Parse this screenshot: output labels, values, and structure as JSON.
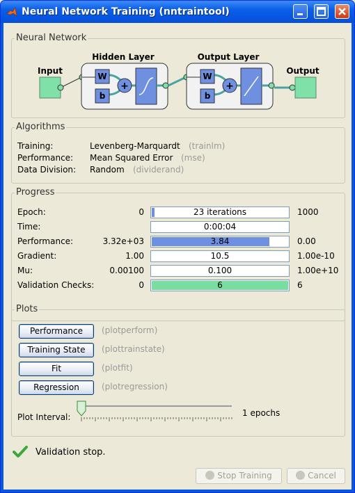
{
  "window": {
    "title": "Neural Network Training (nntraintool)"
  },
  "network": {
    "section_title": "Neural Network",
    "input_label": "Input",
    "hidden_label": "Hidden Layer",
    "output_layer_label": "Output Layer",
    "output_label": "Output",
    "w_label": "W",
    "b_label": "b",
    "plus_label": "+"
  },
  "algorithms": {
    "section_title": "Algorithms",
    "rows": [
      {
        "label": "Training:",
        "value": "Levenberg-Marquardt",
        "code": "(trainlm)"
      },
      {
        "label": "Performance:",
        "value": "Mean Squared Error",
        "code": "(mse)"
      },
      {
        "label": "Data Division:",
        "value": "Random",
        "code": "(dividerand)"
      }
    ]
  },
  "progress": {
    "section_title": "Progress",
    "rows": [
      {
        "label": "Epoch:",
        "start": "0",
        "current": "23 iterations",
        "end": "1000",
        "fill": 0.02,
        "fill_color": "#6f8fe0"
      },
      {
        "label": "Time:",
        "start": "",
        "current": "0:00:04",
        "end": "",
        "fill": 0,
        "fill_color": "#6f8fe0"
      },
      {
        "label": "Performance:",
        "start": "3.32e+03",
        "current": "3.84",
        "end": "0.00",
        "fill": 0.86,
        "fill_color": "#6f8fe0"
      },
      {
        "label": "Gradient:",
        "start": "1.00",
        "current": "10.5",
        "end": "1.00e-10",
        "fill": 0,
        "fill_color": "#6f8fe0"
      },
      {
        "label": "Mu:",
        "start": "0.00100",
        "current": "0.100",
        "end": "1.00e+10",
        "fill": 0,
        "fill_color": "#6f8fe0"
      },
      {
        "label": "Validation Checks:",
        "start": "0",
        "current": "6",
        "end": "6",
        "fill": 1.0,
        "fill_color": "#79dca0"
      }
    ]
  },
  "plots": {
    "section_title": "Plots",
    "buttons": [
      {
        "label": "Performance",
        "code": "(plotperform)"
      },
      {
        "label": "Training State",
        "code": "(plottrainstate)"
      },
      {
        "label": "Fit",
        "code": "(plotfit)"
      },
      {
        "label": "Regression",
        "code": "(plotregression)"
      }
    ],
    "interval_label": "Plot Interval:",
    "interval_value": "1 epochs",
    "slider_level": 0
  },
  "status": {
    "text": "Validation stop."
  },
  "footer": {
    "stop_label": "Stop Training",
    "cancel_label": "Cancel"
  },
  "colors": {
    "accent_blue": "#6f8fe0",
    "validation_green": "#79dca0",
    "io_box": "#7fe0a8"
  }
}
